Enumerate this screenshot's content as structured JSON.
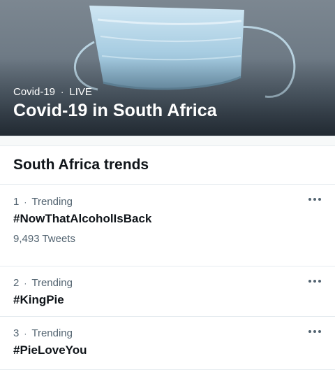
{
  "hero": {
    "category": "Covid-19",
    "separator": "·",
    "status": "LIVE",
    "title": "Covid-19 in South Africa"
  },
  "trends_section": {
    "title": "South Africa trends",
    "items": [
      {
        "rank": "1",
        "separator": "·",
        "label": "Trending",
        "hashtag": "#NowThatAlcoholIsBack",
        "tweets": "9,493 Tweets"
      },
      {
        "rank": "2",
        "separator": "·",
        "label": "Trending",
        "hashtag": "#KingPie"
      },
      {
        "rank": "3",
        "separator": "·",
        "label": "Trending",
        "hashtag": "#PieLoveYou"
      }
    ]
  },
  "colors": {
    "primary_text": "#0f1419",
    "secondary_text": "#536471",
    "divider": "#e6ecf0"
  },
  "icons": {
    "more": "more-horizontal-icon",
    "hero_image": "face-mask-image"
  }
}
